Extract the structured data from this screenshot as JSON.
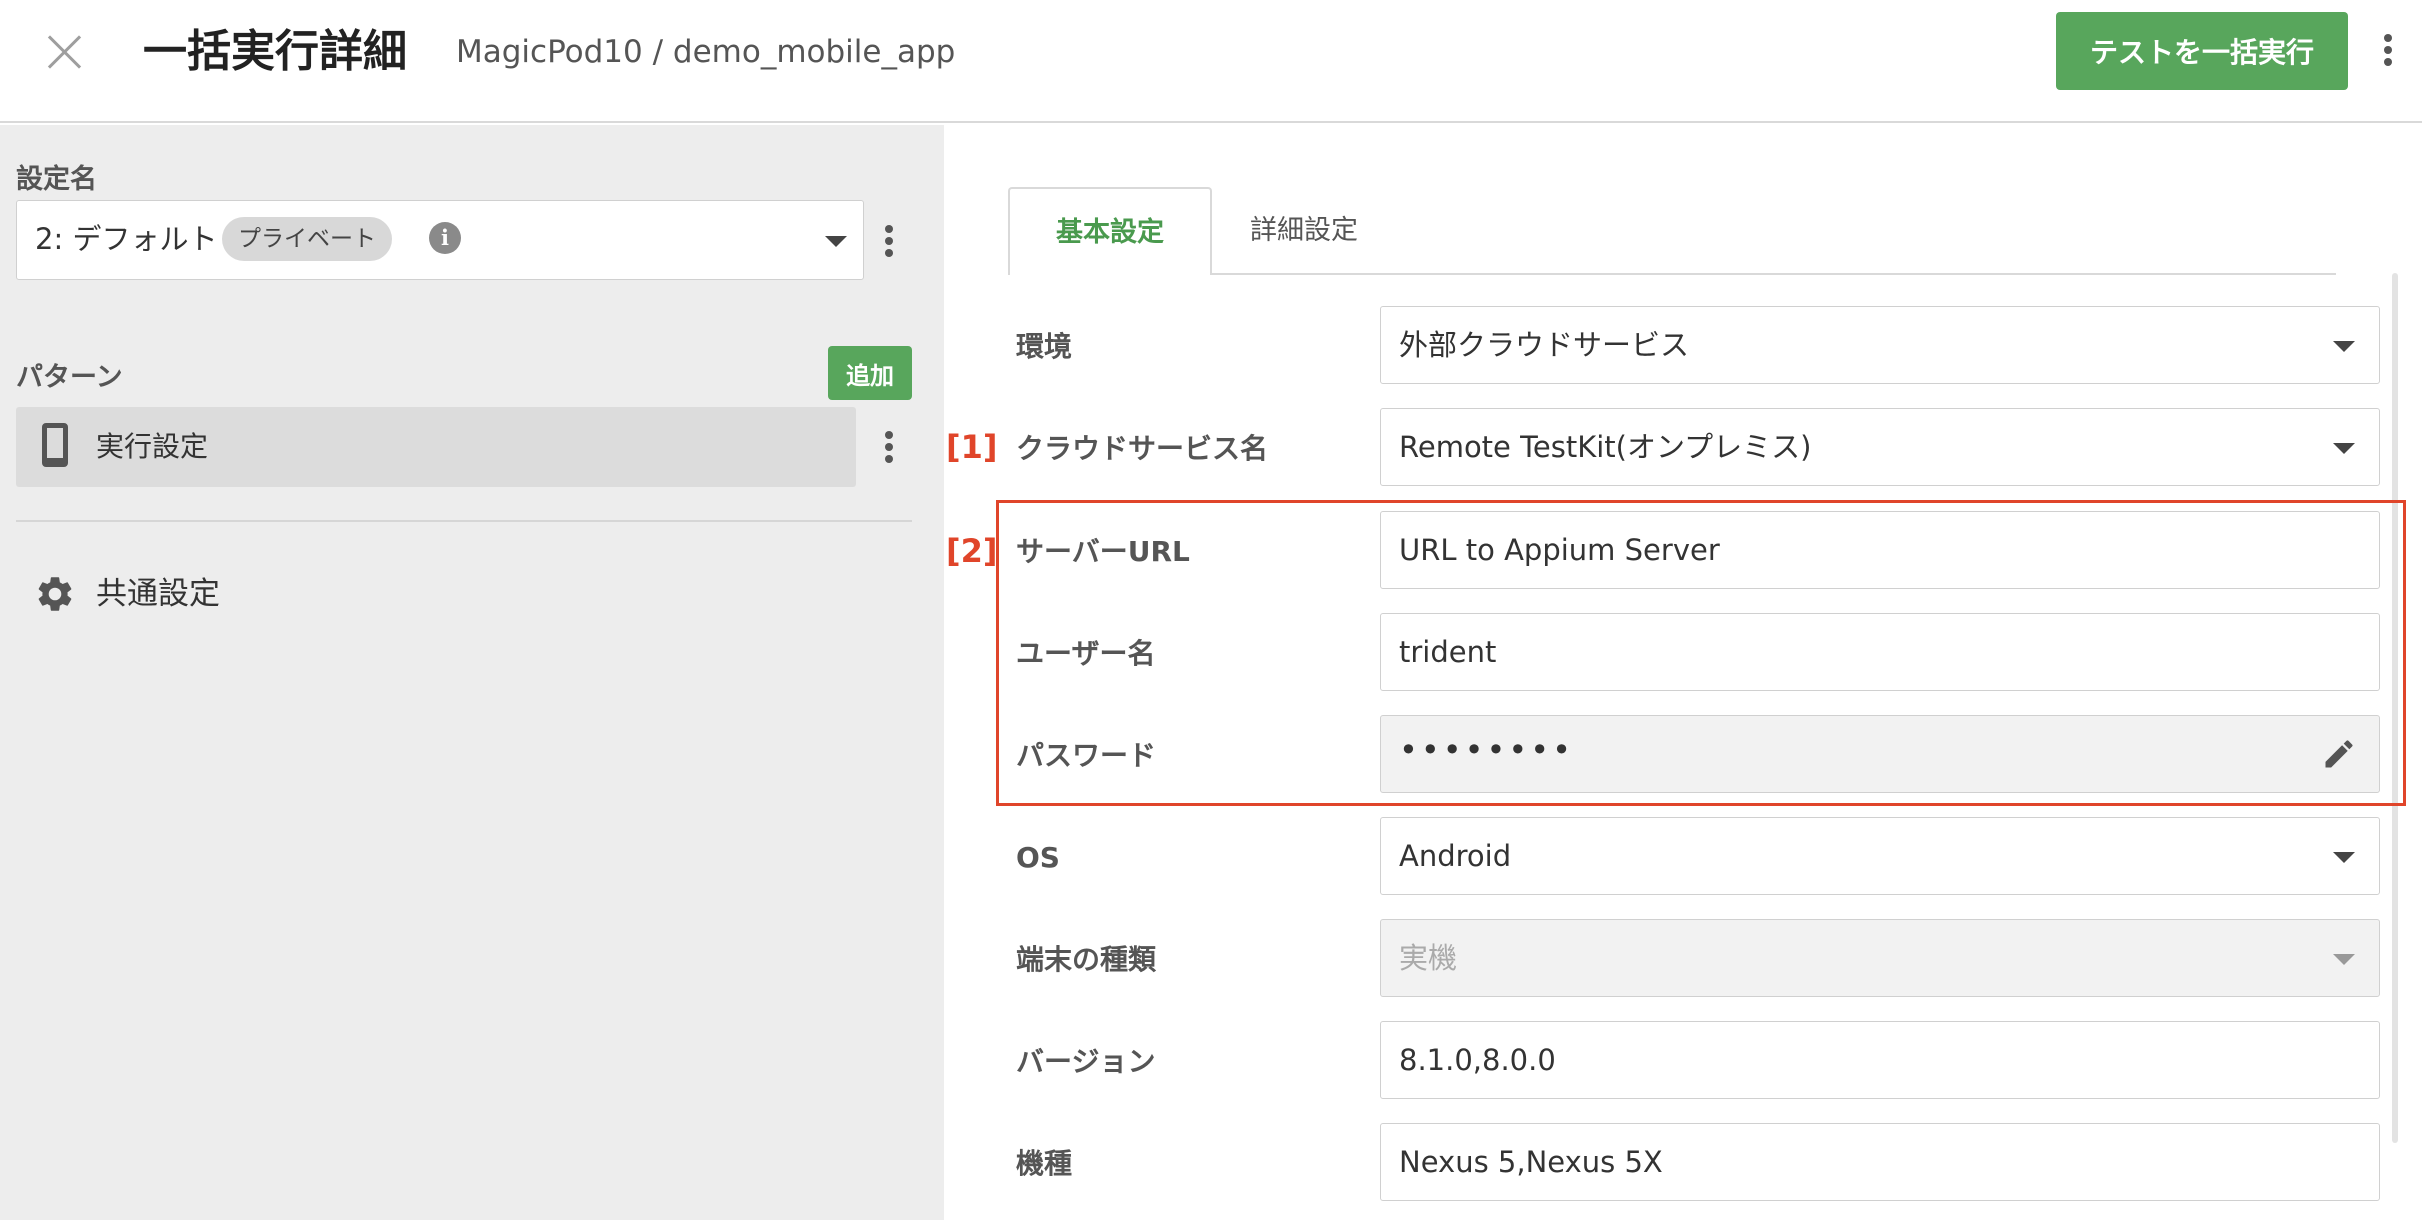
{
  "header": {
    "title": "一括実行詳細",
    "breadcrumb": "MagicPod10 / demo_mobile_app",
    "run_all_label": "テストを一括実行"
  },
  "left": {
    "setting_name_label": "設定名",
    "setting_value": "2: デフォルト",
    "visibility_badge": "プライベート",
    "pattern_label": "パターン",
    "add_label": "追加",
    "pattern_item": "実行設定",
    "common_settings": "共通設定"
  },
  "tabs": {
    "basic": "基本設定",
    "detail": "詳細設定"
  },
  "markers": {
    "m1": "[1]",
    "m2": "[2]"
  },
  "form": {
    "environment": {
      "label": "環境",
      "value": "外部クラウドサービス"
    },
    "cloud_service": {
      "label": "クラウドサービス名",
      "value": "Remote TestKit(オンプレミス)"
    },
    "server_url": {
      "label": "サーバーURL",
      "value": "URL to Appium Server"
    },
    "username": {
      "label": "ユーザー名",
      "value": "trident"
    },
    "password": {
      "label": "パスワード",
      "value": "••••••••"
    },
    "os": {
      "label": "OS",
      "value": "Android"
    },
    "device_type": {
      "label": "端末の種類",
      "value": "実機"
    },
    "version": {
      "label": "バージョン",
      "value": "8.1.0,8.0.0"
    },
    "model": {
      "label": "機種",
      "value": "Nexus 5,Nexus 5X"
    }
  },
  "colors": {
    "accent_green": "#58a65c",
    "marker_red": "#e0452a",
    "left_bg": "#ededed"
  },
  "icons": [
    "close-icon",
    "kebab-icon",
    "info-icon",
    "chevron-down-icon",
    "phone-icon",
    "gear-icon",
    "pencil-icon"
  ]
}
